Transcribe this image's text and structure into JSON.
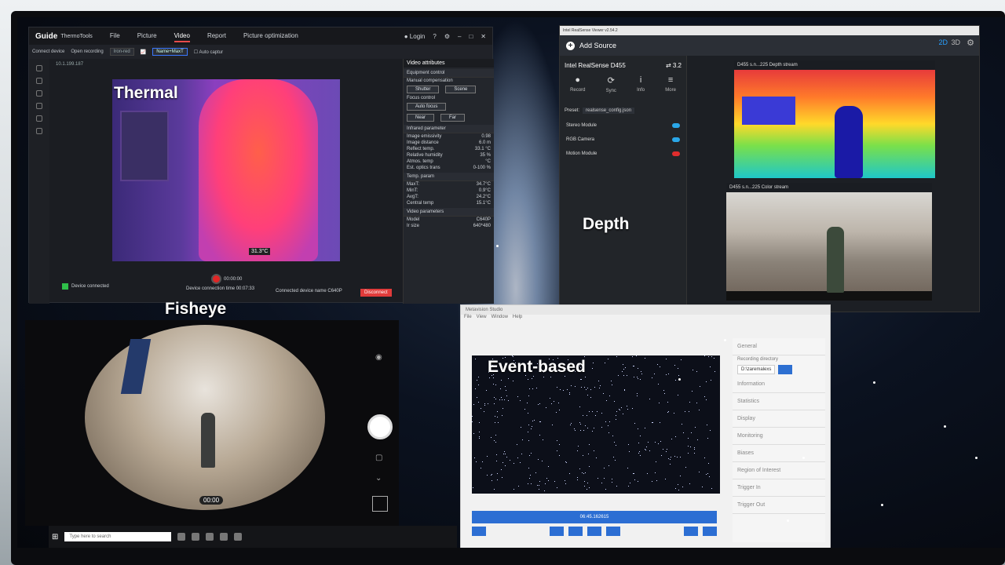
{
  "overlay_labels": {
    "thermal": "Thermal",
    "depth": "Depth",
    "fisheye": "Fisheye",
    "event": "Event-based"
  },
  "thermal_app": {
    "logo": "Guide",
    "logo_sub": "ThermoTools",
    "menu": [
      "File",
      "Picture",
      "Video",
      "Report",
      "Picture optimization"
    ],
    "active_menu": "Video",
    "login": "Login",
    "toolbar": {
      "connect": "Connect device",
      "open_recording": "Open recording",
      "mode": "Iron-red",
      "filter": "Name+MaxT",
      "auto_capture": "Auto captur"
    },
    "ip": "10.1.199.187",
    "temp_label": "31.3°C",
    "rec_time": "00:00:00",
    "device_connected": "Device connected",
    "device_connection_time_label": "Device connection time",
    "device_connection_time": "00:07:33",
    "connected_device_name_label": "Connected device name",
    "connected_device_name": "C640P",
    "disconnect": "Disconnect",
    "panel": {
      "title": "Video attributes",
      "equipment_control": "Equipment control",
      "manual_compensation": "Manual compensation",
      "shutter": "Shutter",
      "scene": "Scene",
      "focus_control": "Focus control",
      "auto_focus": "Auto focus",
      "near": "Near",
      "far": "Far",
      "infrared_parameter": "Infrared parameter",
      "params": [
        {
          "label": "Image emissivity",
          "value": "0.98"
        },
        {
          "label": "Image distance",
          "value": "6.0 m"
        },
        {
          "label": "Reflect temp.",
          "value": "33.1 °C"
        },
        {
          "label": "Relative humidity",
          "value": "35 %"
        },
        {
          "label": "Atmos. temp",
          "value": "°C"
        },
        {
          "label": "Est. optics trans",
          "value": "0-100 %"
        }
      ],
      "temp_param": "Temp. param",
      "temps": [
        {
          "label": "MaxT:",
          "value": "34.7°C"
        },
        {
          "label": "MinT:",
          "value": "0.9°C"
        },
        {
          "label": "AvgT:",
          "value": "24.2°C"
        },
        {
          "label": "Central temp",
          "value": "15.1°C"
        }
      ],
      "video_parameters": "Video parameters",
      "video": [
        {
          "label": "Model",
          "value": "C640P"
        },
        {
          "label": "Ir size",
          "value": "640*480"
        }
      ]
    }
  },
  "realsense": {
    "title": "Intel RealSense Viewer v2.54.2",
    "add_source": "Add Source",
    "mode_2d": "2D",
    "mode_3d": "3D",
    "device": "Intel RealSense D455",
    "usb": "3.2",
    "actions": [
      {
        "icon": "●",
        "label": "Record"
      },
      {
        "icon": "⟳",
        "label": "Sync"
      },
      {
        "icon": "i",
        "label": "Info"
      },
      {
        "icon": "≡",
        "label": "More"
      }
    ],
    "preset_label": "Preset:",
    "preset_value": "realsense_config.json",
    "modules": [
      {
        "name": "Stereo Module",
        "state": "on"
      },
      {
        "name": "RGB Camera",
        "state": "on"
      },
      {
        "name": "Motion Module",
        "state": "off"
      }
    ],
    "depth_stream": "D455 s.n...225 Depth stream",
    "color_stream": "D455 s.n...225 Color stream"
  },
  "fisheye": {
    "time": "00:00"
  },
  "event_app": {
    "title": "Metavision Studio",
    "menu": [
      "File",
      "View",
      "Window",
      "Help"
    ],
    "sidebar": [
      "General",
      "Information",
      "Statistics",
      "Display",
      "Monitoring",
      "Biases",
      "Region of Interest",
      "Trigger In",
      "Trigger Out"
    ],
    "recording_directory_label": "Recording directory",
    "recording_directory": "D:\\zaremalexs",
    "timestamp": "06:45.162615"
  },
  "taskbar": {
    "search_placeholder": "Type here to search"
  }
}
